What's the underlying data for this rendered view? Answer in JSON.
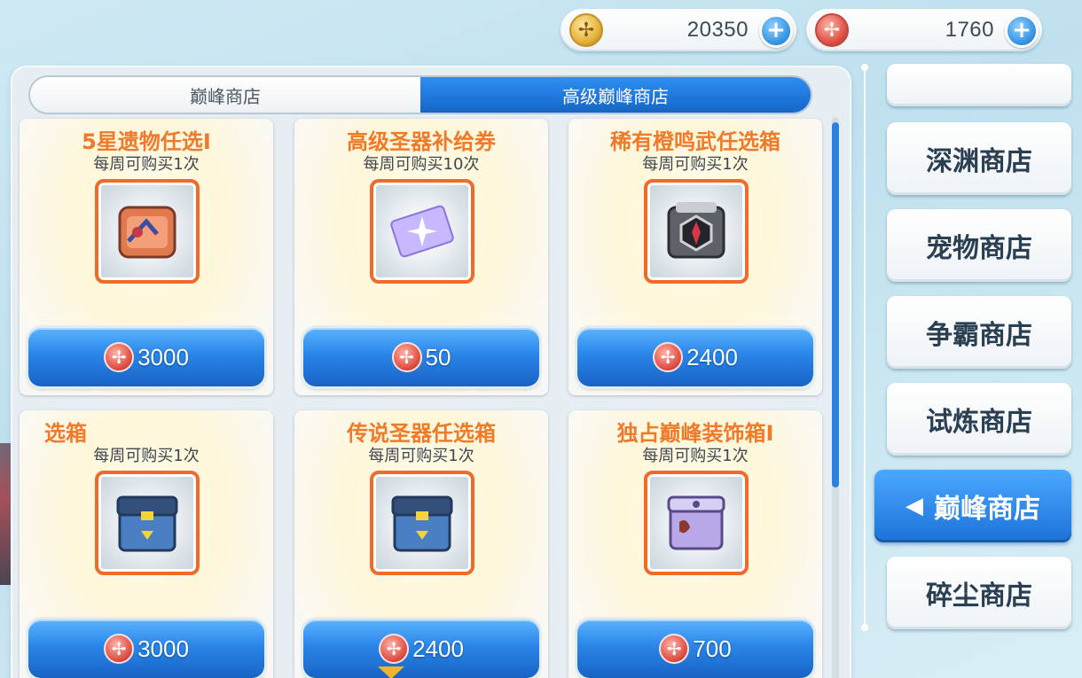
{
  "currency": {
    "gold": {
      "amount": "20350",
      "icon": "gold-coin-icon"
    },
    "red": {
      "amount": "1760",
      "icon": "red-coin-icon"
    },
    "plus_label": "+"
  },
  "tabs": [
    {
      "label": "巅峰商店",
      "active": false
    },
    {
      "label": "高级巅峰商店",
      "active": true
    }
  ],
  "items": [
    {
      "title": "5星遗物任选Ⅰ",
      "limit": "每周可购买1次",
      "price": "3000",
      "icon": "relic-chest-icon"
    },
    {
      "title": "高级圣器补给券",
      "limit": "每周可购买10次",
      "price": "50",
      "icon": "ticket-icon"
    },
    {
      "title": "稀有橙鸣武任选箱",
      "limit": "每周可购买1次",
      "price": "2400",
      "icon": "weapon-box-icon"
    },
    {
      "title": "选箱",
      "limit": "每周可购买1次",
      "price": "3000",
      "icon": "blue-chest-icon"
    },
    {
      "title": "传说圣器任选箱",
      "limit": "每周可购买1次",
      "price": "2400",
      "icon": "blue-chest-icon"
    },
    {
      "title": "独占巅峰装饰箱Ⅰ",
      "limit": "每周可购买1次",
      "price": "700",
      "icon": "purple-box-icon"
    }
  ],
  "price_icon": "red-coin-icon",
  "nav": {
    "items": [
      {
        "label": "深渊商店"
      },
      {
        "label": "宠物商店"
      },
      {
        "label": "争霸商店"
      },
      {
        "label": "试炼商店"
      },
      {
        "label": "巅峰商店",
        "active": true
      },
      {
        "label": "碎尘商店"
      }
    ],
    "active_arrow": "◀"
  },
  "colors": {
    "accent_blue": "#1c72d8",
    "title_orange": "#f07a2a"
  }
}
